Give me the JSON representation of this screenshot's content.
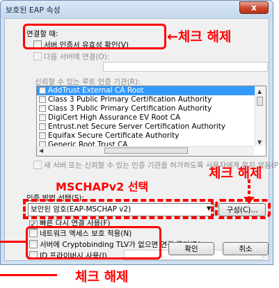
{
  "window": {
    "title": "보호된 EAP 속성",
    "close_glyph": "x"
  },
  "connect_section": {
    "label": "연결할 때:",
    "verify_cert": "서버 인증서 유효성 확인(V)",
    "connect_to_servers": "다음 서버에 연결(O):"
  },
  "trusted_root": {
    "label": "신뢰할 수 있는 루트 인증 기관(R):",
    "items": [
      "AddTrust External CA Root",
      "Class 3 Public Primary Certification Authority",
      "Class 3 Public Primary Certification Authority",
      "DigiCert High Assurance EV Root CA",
      "Entrust.net Secure Server Certification Authority",
      "Equifax Secure Certificate Authority",
      "Generic Root Trust CA"
    ]
  },
  "no_prompt": "새 서버 또는 신뢰할 수 있는 인증 기관을 허가하도록 사용자에게 묻지 않음(P)",
  "auth_method": {
    "label": "인증 방법 선택(S):",
    "selected": "보안된 암호(EAP-MSCHAP v2)",
    "configure": "구성(C)..."
  },
  "options": {
    "fast_reconnect": "빠른 다시 연결 사용(F)",
    "nap": "네트워크 액세스 보호 적용(N)",
    "cryptobinding": "서버에 Cryptobinding TLV가 없으면 연결 끊기(D)",
    "identity_privacy": "ID 프라이버시 사용(I)"
  },
  "buttons": {
    "ok": "확인",
    "cancel": "취소"
  },
  "annotations": {
    "uncheck_top": "←체크 해제",
    "uncheck_right": "체크 해제",
    "mschap": "MSCHAPv2 선택",
    "uncheck_bottom": "체크 해제"
  },
  "colors": {
    "annotation": "#ff0000",
    "selection": "#3399ff"
  }
}
